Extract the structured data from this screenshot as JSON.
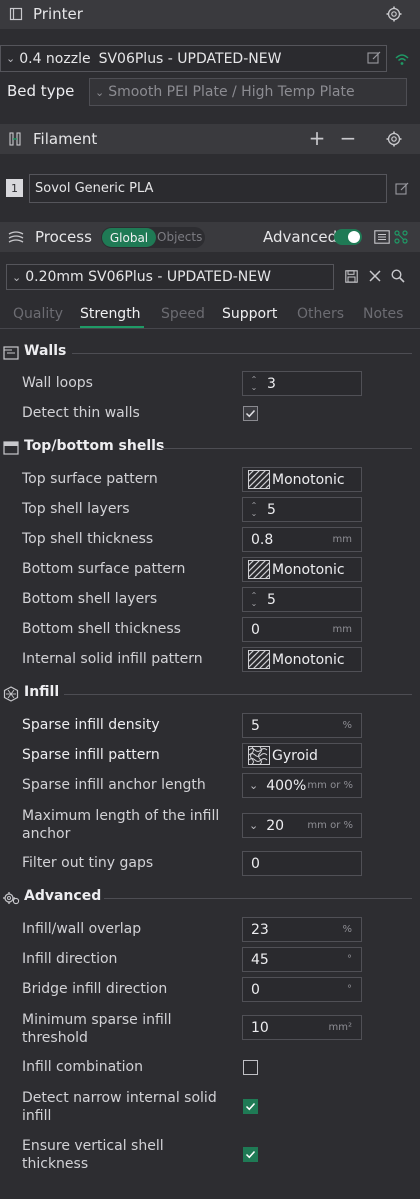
{
  "printer": {
    "title": "Printer",
    "nozzle": "0.4 nozzle",
    "preset": "SV06Plus - UPDATED-NEW",
    "bed_type_label": "Bed type",
    "bed_type_value": "Smooth PEI Plate / High Temp Plate"
  },
  "filament": {
    "title": "Filament",
    "slot_number": "1",
    "name": "Sovol Generic PLA"
  },
  "process": {
    "title": "Process",
    "toggle_global": "Global",
    "toggle_objects": "Objects",
    "advanced_label": "Advanced",
    "preset": "0.20mm SV06Plus - UPDATED-NEW"
  },
  "tabs": [
    {
      "label": "Quality"
    },
    {
      "label": "Strength"
    },
    {
      "label": "Speed"
    },
    {
      "label": "Support"
    },
    {
      "label": "Others"
    },
    {
      "label": "Notes"
    }
  ],
  "walls": {
    "title": "Walls",
    "wall_loops": {
      "label": "Wall loops",
      "value": "3"
    },
    "detect_thin": {
      "label": "Detect thin walls",
      "checked": true
    }
  },
  "shells": {
    "title": "Top/bottom shells",
    "top_pattern": {
      "label": "Top surface pattern",
      "value": "Monotonic"
    },
    "top_layers": {
      "label": "Top shell layers",
      "value": "5"
    },
    "top_thickness": {
      "label": "Top shell thickness",
      "value": "0.8",
      "unit": "mm"
    },
    "bottom_pattern": {
      "label": "Bottom surface pattern",
      "value": "Monotonic"
    },
    "bottom_layers": {
      "label": "Bottom shell layers",
      "value": "5"
    },
    "bottom_thickness": {
      "label": "Bottom shell thickness",
      "value": "0",
      "unit": "mm"
    },
    "internal_pattern": {
      "label": "Internal solid infill pattern",
      "value": "Monotonic"
    }
  },
  "infill": {
    "title": "Infill",
    "density": {
      "label": "Sparse infill density",
      "value": "5",
      "unit": "%"
    },
    "pattern": {
      "label": "Sparse infill pattern",
      "value": "Gyroid"
    },
    "anchor": {
      "label": "Sparse infill anchor length",
      "value": "400%",
      "unit": "mm or %"
    },
    "max_anchor": {
      "label": "Maximum length of the infill anchor",
      "value": "20",
      "unit": "mm or %"
    },
    "filter_gaps": {
      "label": "Filter out tiny gaps",
      "value": "0"
    }
  },
  "advanced": {
    "title": "Advanced",
    "overlap": {
      "label": "Infill/wall overlap",
      "value": "23",
      "unit": "%"
    },
    "direction": {
      "label": "Infill direction",
      "value": "45",
      "unit": "°"
    },
    "bridge_direction": {
      "label": "Bridge infill direction",
      "value": "0",
      "unit": "°"
    },
    "min_threshold": {
      "label": "Minimum sparse infill threshold",
      "value": "10",
      "unit": "mm²"
    },
    "combination": {
      "label": "Infill combination",
      "checked": false
    },
    "narrow_solid": {
      "label": "Detect narrow internal solid infill",
      "checked": true
    },
    "vertical_shell": {
      "label": "Ensure vertical shell thickness",
      "checked": true
    }
  },
  "colors": {
    "accent": "#1f7a55",
    "background": "#2d2d31",
    "header": "#3a3a3e"
  }
}
